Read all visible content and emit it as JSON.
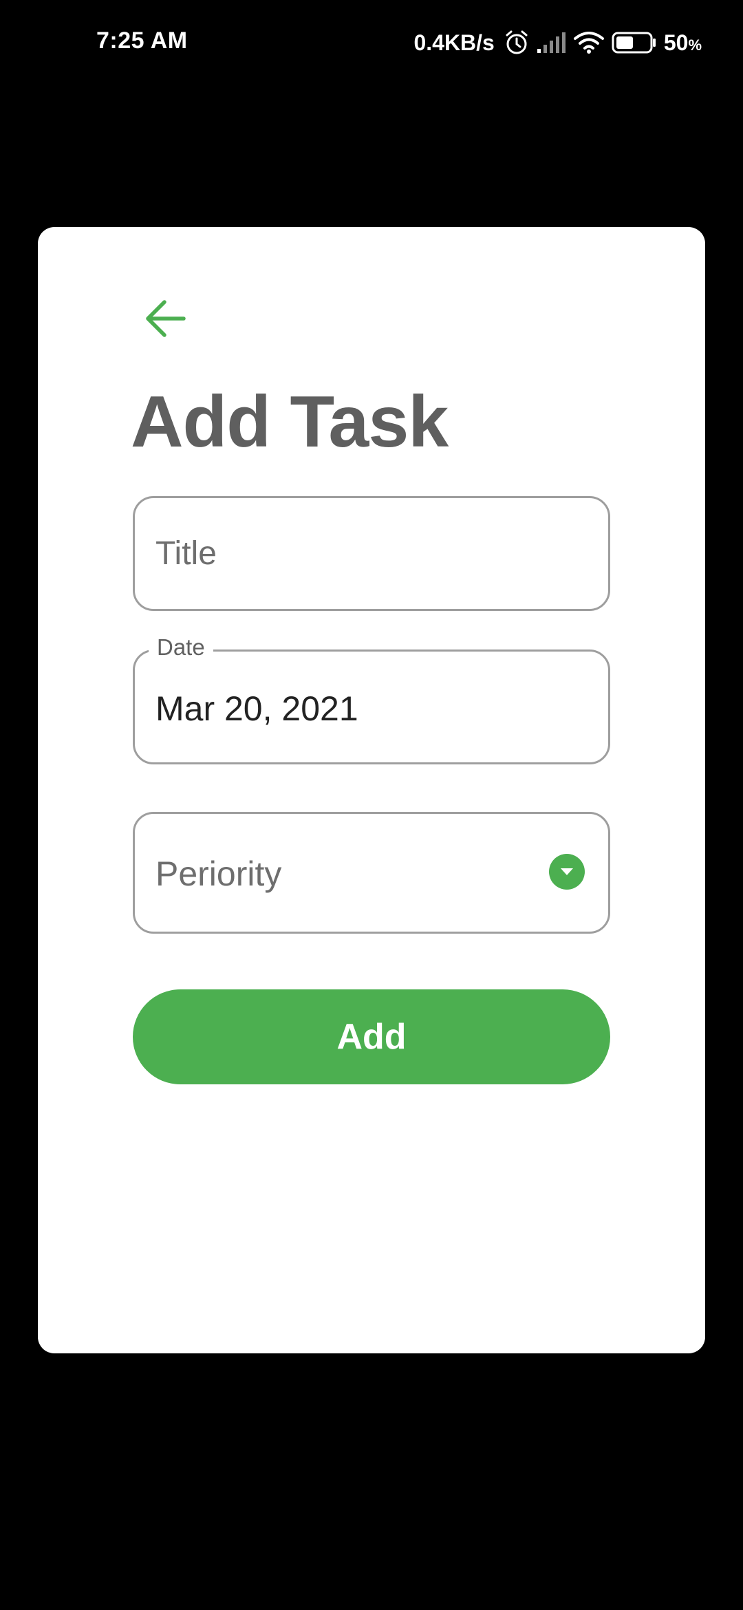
{
  "status_bar": {
    "time": "7:25 AM",
    "net_speed": "0.4KB/s",
    "battery_percent": "50",
    "battery_sign": "%",
    "icons": [
      "alarm-icon",
      "signal-icon",
      "wifi-icon",
      "battery-icon"
    ]
  },
  "colors": {
    "accent": "#4caf50",
    "title_text": "#5f5f5f",
    "border": "#9e9e9e",
    "background": "#000000",
    "card": "#ffffff"
  },
  "screen": {
    "back_icon": "arrow-left-icon",
    "title": "Add Task"
  },
  "form": {
    "title_field": {
      "placeholder": "Title",
      "value": ""
    },
    "date_field": {
      "label": "Date",
      "value": "Mar 20, 2021"
    },
    "priority_field": {
      "placeholder": "Periority",
      "icon": "dropdown-arrow-icon"
    },
    "submit_label": "Add"
  }
}
